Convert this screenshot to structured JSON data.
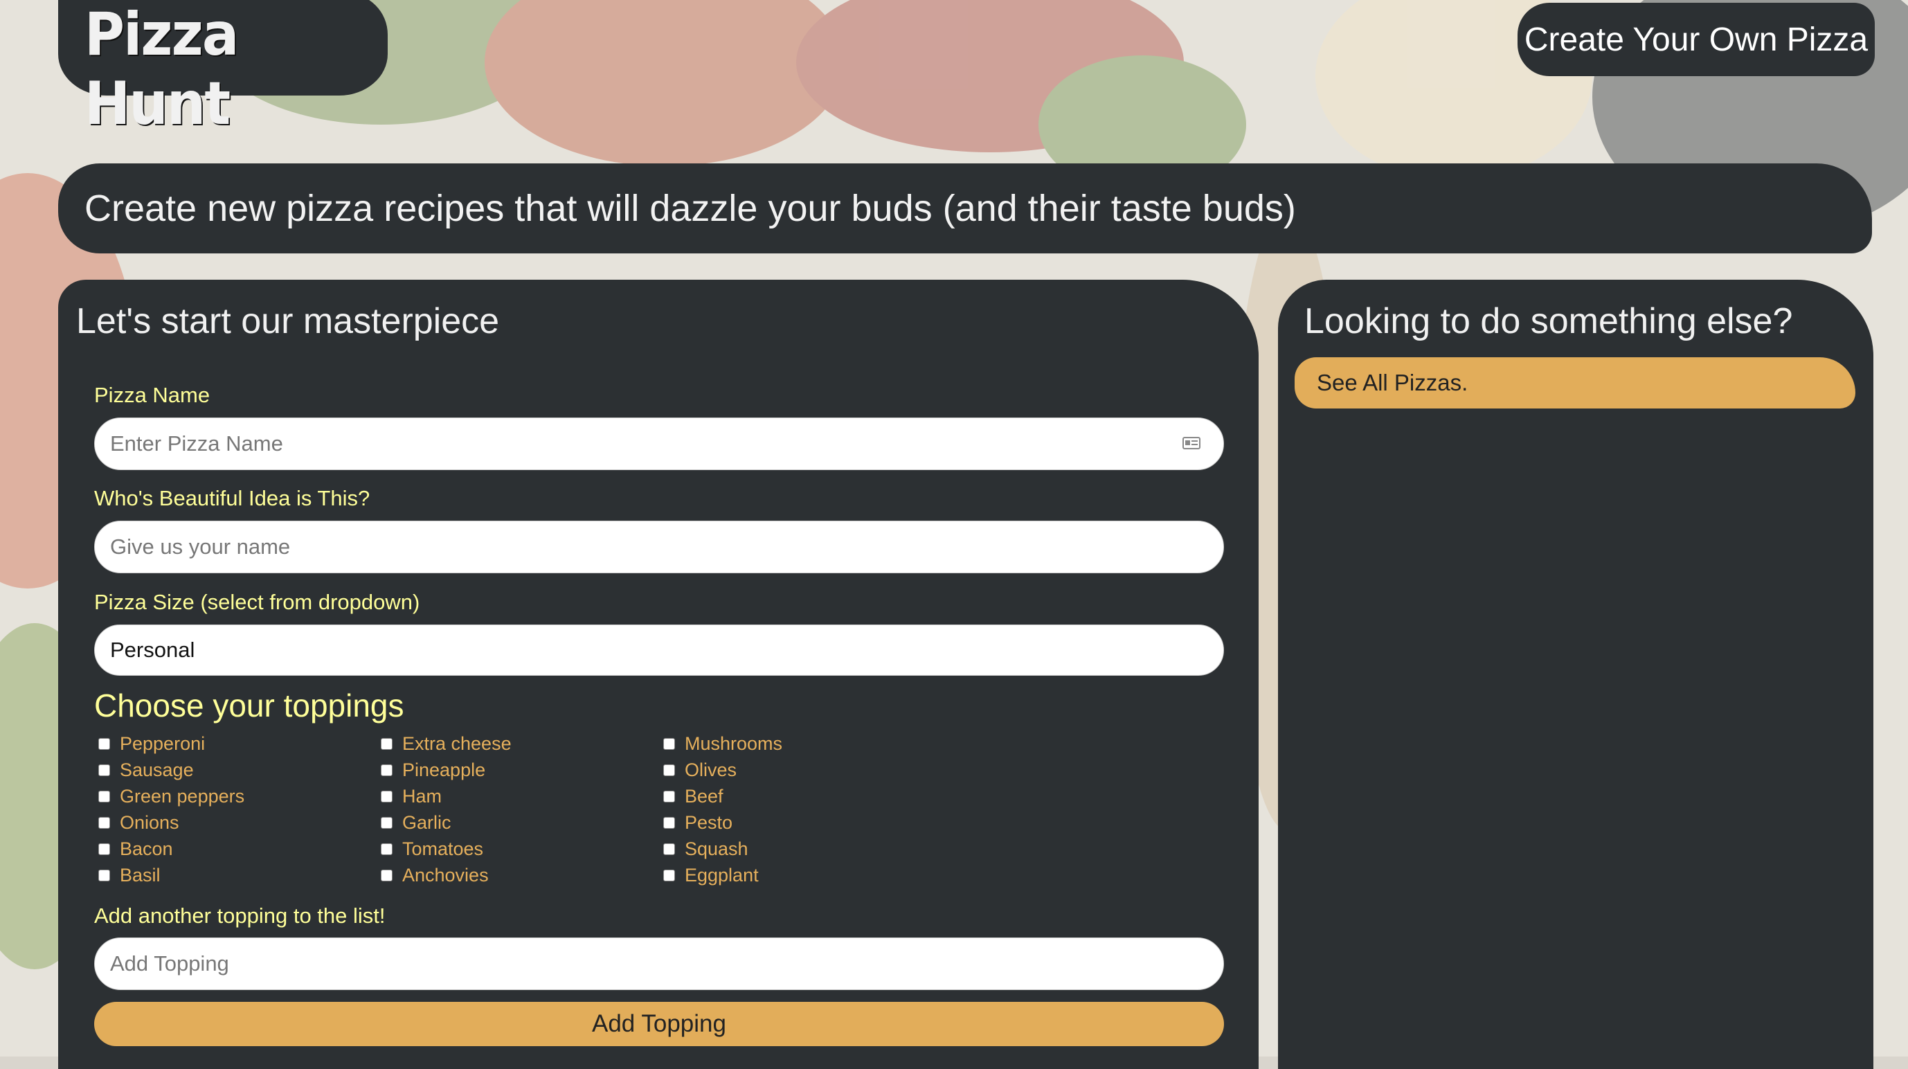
{
  "header": {
    "logo_text": "Pizza Hunt",
    "nav_button": "Create Your Own Pizza"
  },
  "banner": {
    "tagline": "Create new pizza recipes that will dazzle your buds (and their taste buds)"
  },
  "form": {
    "title": "Let's start our masterpiece",
    "pizza_name": {
      "label": "Pizza Name",
      "placeholder": "Enter Pizza Name",
      "value": ""
    },
    "creator": {
      "label": "Who's Beautiful Idea is This?",
      "placeholder": "Give us your name",
      "value": ""
    },
    "size": {
      "label": "Pizza Size (select from dropdown)",
      "selected": "Personal"
    },
    "toppings": {
      "heading": "Choose your toppings",
      "columns": [
        [
          "Pepperoni",
          "Sausage",
          "Green peppers",
          "Onions",
          "Bacon",
          "Basil"
        ],
        [
          "Extra cheese",
          "Pineapple",
          "Ham",
          "Garlic",
          "Tomatoes",
          "Anchovies"
        ],
        [
          "Mushrooms",
          "Olives",
          "Beef",
          "Pesto",
          "Squash",
          "Eggplant"
        ]
      ]
    },
    "add_topping": {
      "label": "Add another topping to the list!",
      "placeholder": "Add Topping",
      "value": "",
      "button": "Add Topping"
    }
  },
  "sidebar": {
    "title": "Looking to do something else?",
    "link": "See All Pizzas."
  },
  "colors": {
    "panel": "#2c3033",
    "label_yellow": "#ffff99",
    "topping_orange": "#e6b05c",
    "accent_button": "#e2ad5a"
  },
  "icons": {
    "autofill": "contact-card-icon",
    "checkbox": "checkbox-icon"
  }
}
